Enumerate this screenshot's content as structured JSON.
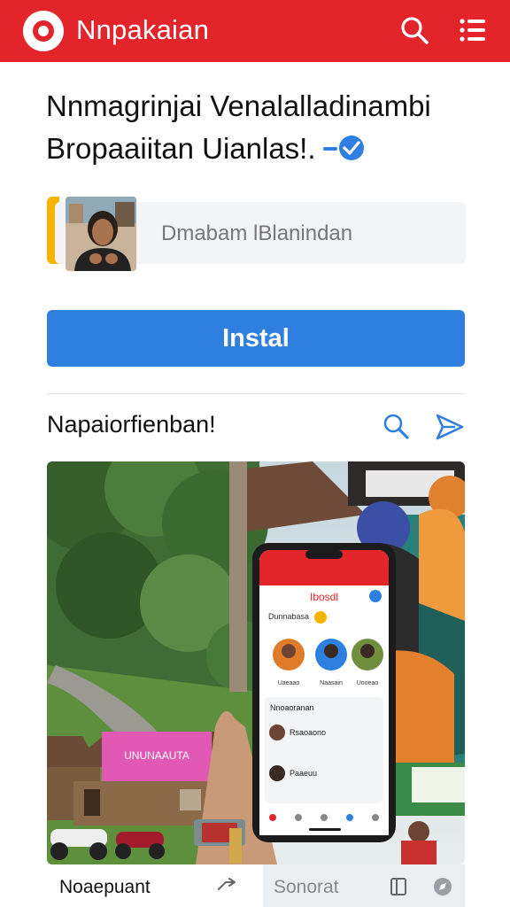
{
  "header": {
    "app_name": "Nnpakaian",
    "brand_color": "#e3242b"
  },
  "headline": {
    "line1": "Nnmagrinjai Venalalladinambi",
    "line2": "Bropaaiitan Uianlas!."
  },
  "profile": {
    "label": "Dmabam lBlanindan"
  },
  "install": {
    "label": "Instal",
    "color": "#2e7fe0"
  },
  "section": {
    "title": "Napaiorfienban!"
  },
  "phone": {
    "app_title": "Ibosdl",
    "tag": "Dunnabasa",
    "list_title": "Nnoaoranan",
    "rows": [
      "Rsaoaono",
      "Paaeuu"
    ],
    "people_names": [
      "Uaeaao",
      "Naasain",
      "Uooeao"
    ]
  },
  "sign": {
    "text": "UNUNAAUTA"
  },
  "bottom": {
    "left_label": "Noaepuant",
    "right_label": "Sonorat"
  }
}
